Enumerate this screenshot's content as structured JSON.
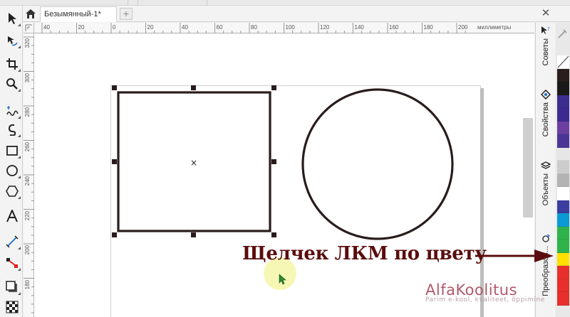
{
  "tabbar": {
    "doc_title": "Безымянный-1*",
    "add_tab": "+",
    "close_glyph": "✕"
  },
  "rulers": {
    "unit": "миллиметры",
    "top_ticks": [
      "40",
      "20",
      "0",
      "20",
      "40",
      "60",
      "80",
      "100",
      "120",
      "140",
      "160",
      "180",
      "200"
    ],
    "left_ticks": [
      "320",
      "300",
      "280",
      "260",
      "240",
      "220",
      "200",
      "180"
    ]
  },
  "toolbox": {
    "tools": [
      {
        "name": "pick-tool-icon",
        "interactive": true
      },
      {
        "name": "shape-tool-icon",
        "interactive": true
      },
      {
        "name": "crop-tool-icon",
        "interactive": true
      },
      {
        "name": "zoom-tool-icon",
        "interactive": true
      },
      {
        "name": "freehand-tool-icon",
        "interactive": true
      },
      {
        "name": "artistic-media-icon",
        "interactive": true
      },
      {
        "name": "rectangle-tool-icon",
        "interactive": true
      },
      {
        "name": "ellipse-tool-icon",
        "interactive": true
      },
      {
        "name": "polygon-tool-icon",
        "interactive": true
      },
      {
        "name": "text-tool-icon",
        "interactive": true
      },
      {
        "name": "parallel-dimension-icon",
        "interactive": true
      },
      {
        "name": "connector-tool-icon",
        "interactive": true
      },
      {
        "name": "drop-shadow-icon",
        "interactive": true
      },
      {
        "name": "transparency-tool-icon",
        "interactive": true
      }
    ]
  },
  "docker": {
    "tabs": [
      {
        "label": "Советы",
        "icon": "hints-icon"
      },
      {
        "label": "Свойства",
        "icon": "properties-icon"
      },
      {
        "label": "Объекты",
        "icon": "objects-icon"
      },
      {
        "label": "Преобразов...",
        "icon": "transform-icon"
      }
    ]
  },
  "palette": {
    "colors": [
      "#ffffff",
      "#2a1d1d",
      "#191919",
      "#3b2d8e",
      "#3d2a90",
      "#6b3fa0",
      "#4a3596",
      "#e6e6e6",
      "#cccccc",
      "#b3b3b3",
      "#ffffff",
      "#3a3ca0",
      "#0a9ad4",
      "#2fb34a",
      "#2fb34a",
      "#ffe000",
      "#e7302b",
      "#e7302b",
      "#e7302b"
    ],
    "no_color_label": "no-color"
  },
  "canvas": {
    "selection_center_mark": "×"
  },
  "annotation": {
    "caption": "Щелчек ЛКМ по цвету"
  },
  "watermark": {
    "title": "AlfaKoolitus",
    "subtitle": "Parim e-kool, kvaliteet, õppimine"
  }
}
